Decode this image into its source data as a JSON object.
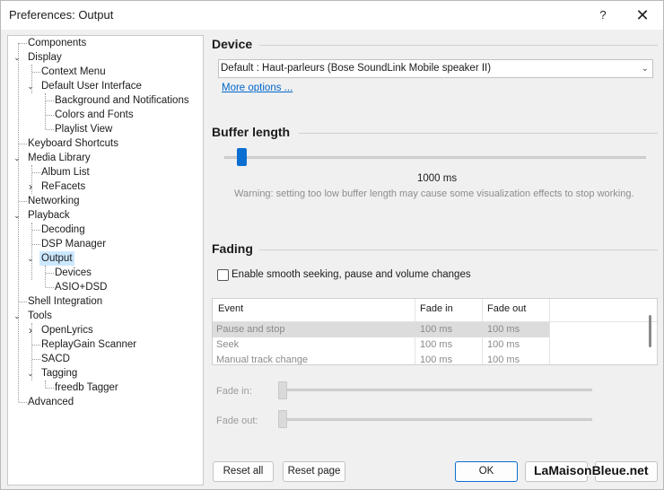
{
  "window": {
    "title": "Preferences: Output",
    "help_label": "?",
    "close_label": "✕"
  },
  "tree": {
    "items": [
      {
        "label": "Components"
      },
      {
        "label": "Display",
        "expander": "⌄"
      },
      {
        "label": "Context Menu"
      },
      {
        "label": "Default User Interface",
        "expander": "⌄"
      },
      {
        "label": "Background and Notifications"
      },
      {
        "label": "Colors and Fonts"
      },
      {
        "label": "Playlist View"
      },
      {
        "label": "Keyboard Shortcuts"
      },
      {
        "label": "Media Library",
        "expander": "⌄"
      },
      {
        "label": "Album List"
      },
      {
        "label": "ReFacets",
        "expander": "›"
      },
      {
        "label": "Networking"
      },
      {
        "label": "Playback",
        "expander": "⌄"
      },
      {
        "label": "Decoding"
      },
      {
        "label": "DSP Manager"
      },
      {
        "label": "Output",
        "expander": "⌄",
        "selected": true
      },
      {
        "label": "Devices"
      },
      {
        "label": "ASIO+DSD"
      },
      {
        "label": "Shell Integration"
      },
      {
        "label": "Tools",
        "expander": "⌄"
      },
      {
        "label": "OpenLyrics",
        "expander": "›"
      },
      {
        "label": "ReplayGain Scanner"
      },
      {
        "label": "SACD"
      },
      {
        "label": "Tagging",
        "expander": "⌄"
      },
      {
        "label": "freedb Tagger"
      },
      {
        "label": "Advanced"
      }
    ]
  },
  "device": {
    "heading": "Device",
    "selected": "Default : Haut-parleurs (Bose SoundLink Mobile speaker II)",
    "more_options": "More options ..."
  },
  "buffer": {
    "heading": "Buffer length",
    "value": "1000 ms",
    "warning": "Warning: setting too low buffer length may cause some visualization effects to stop working."
  },
  "fading": {
    "heading": "Fading",
    "checkbox_label": "Enable smooth seeking, pause and volume changes",
    "checked": false,
    "columns": [
      "Event",
      "Fade in",
      "Fade out"
    ],
    "rows": [
      {
        "event": "Pause and stop",
        "fade_in": "100 ms",
        "fade_out": "100 ms"
      },
      {
        "event": "Seek",
        "fade_in": "100 ms",
        "fade_out": "100 ms"
      },
      {
        "event": "Manual track change",
        "fade_in": "100 ms",
        "fade_out": "100 ms"
      }
    ],
    "fade_in_label": "Fade in:",
    "fade_out_label": "Fade out:"
  },
  "buttons": {
    "reset_all": "Reset all",
    "reset_page": "Reset page",
    "ok": "OK"
  },
  "watermark": "LaMaisonBleue.net"
}
